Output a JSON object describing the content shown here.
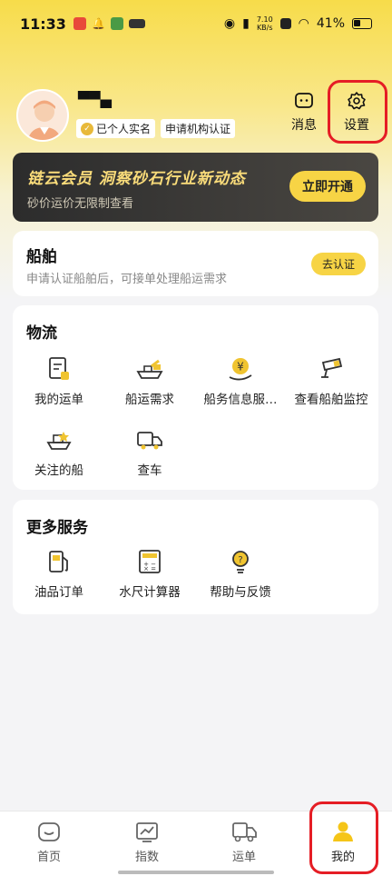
{
  "status_bar": {
    "time": "11:33",
    "net_speed_top": "7.10",
    "net_speed_bottom": "KB/s",
    "battery": "41%"
  },
  "profile": {
    "username": "▀▀▄",
    "badges": [
      "已个人实名",
      "申请机构认证"
    ]
  },
  "top_actions": {
    "message_label": "消息",
    "settings_label": "设置"
  },
  "vip": {
    "title": "链云会员  洞察砂石行业新动态",
    "subtitle": "砂价运价无限制查看",
    "button": "立即开通"
  },
  "ship_card": {
    "title": "船舶",
    "description": "申请认证船舶后，可接单处理船运需求",
    "button": "去认证"
  },
  "logistics": {
    "title": "物流",
    "items": [
      {
        "label": "我的运单",
        "icon": "waybill-icon"
      },
      {
        "label": "船运需求",
        "icon": "ship-demand-icon"
      },
      {
        "label": "船务信息服…",
        "icon": "yuan-service-icon"
      },
      {
        "label": "查看船舶监控",
        "icon": "camera-icon"
      },
      {
        "label": "关注的船",
        "icon": "ship-follow-icon"
      },
      {
        "label": "查车",
        "icon": "truck-icon"
      }
    ]
  },
  "more_services": {
    "title": "更多服务",
    "items": [
      {
        "label": "油品订单",
        "icon": "fuel-icon"
      },
      {
        "label": "水尺计算器",
        "icon": "calculator-icon"
      },
      {
        "label": "帮助与反馈",
        "icon": "lightbulb-icon"
      }
    ]
  },
  "bottom_nav": {
    "items": [
      {
        "label": "首页",
        "icon": "home-icon"
      },
      {
        "label": "指数",
        "icon": "chart-icon"
      },
      {
        "label": "运单",
        "icon": "truck-icon"
      },
      {
        "label": "我的",
        "icon": "person-icon"
      }
    ],
    "active": "我的"
  },
  "colors": {
    "accent": "#f7d445",
    "highlight": "#e51d25",
    "vip_bg": "#2c2c2c"
  }
}
